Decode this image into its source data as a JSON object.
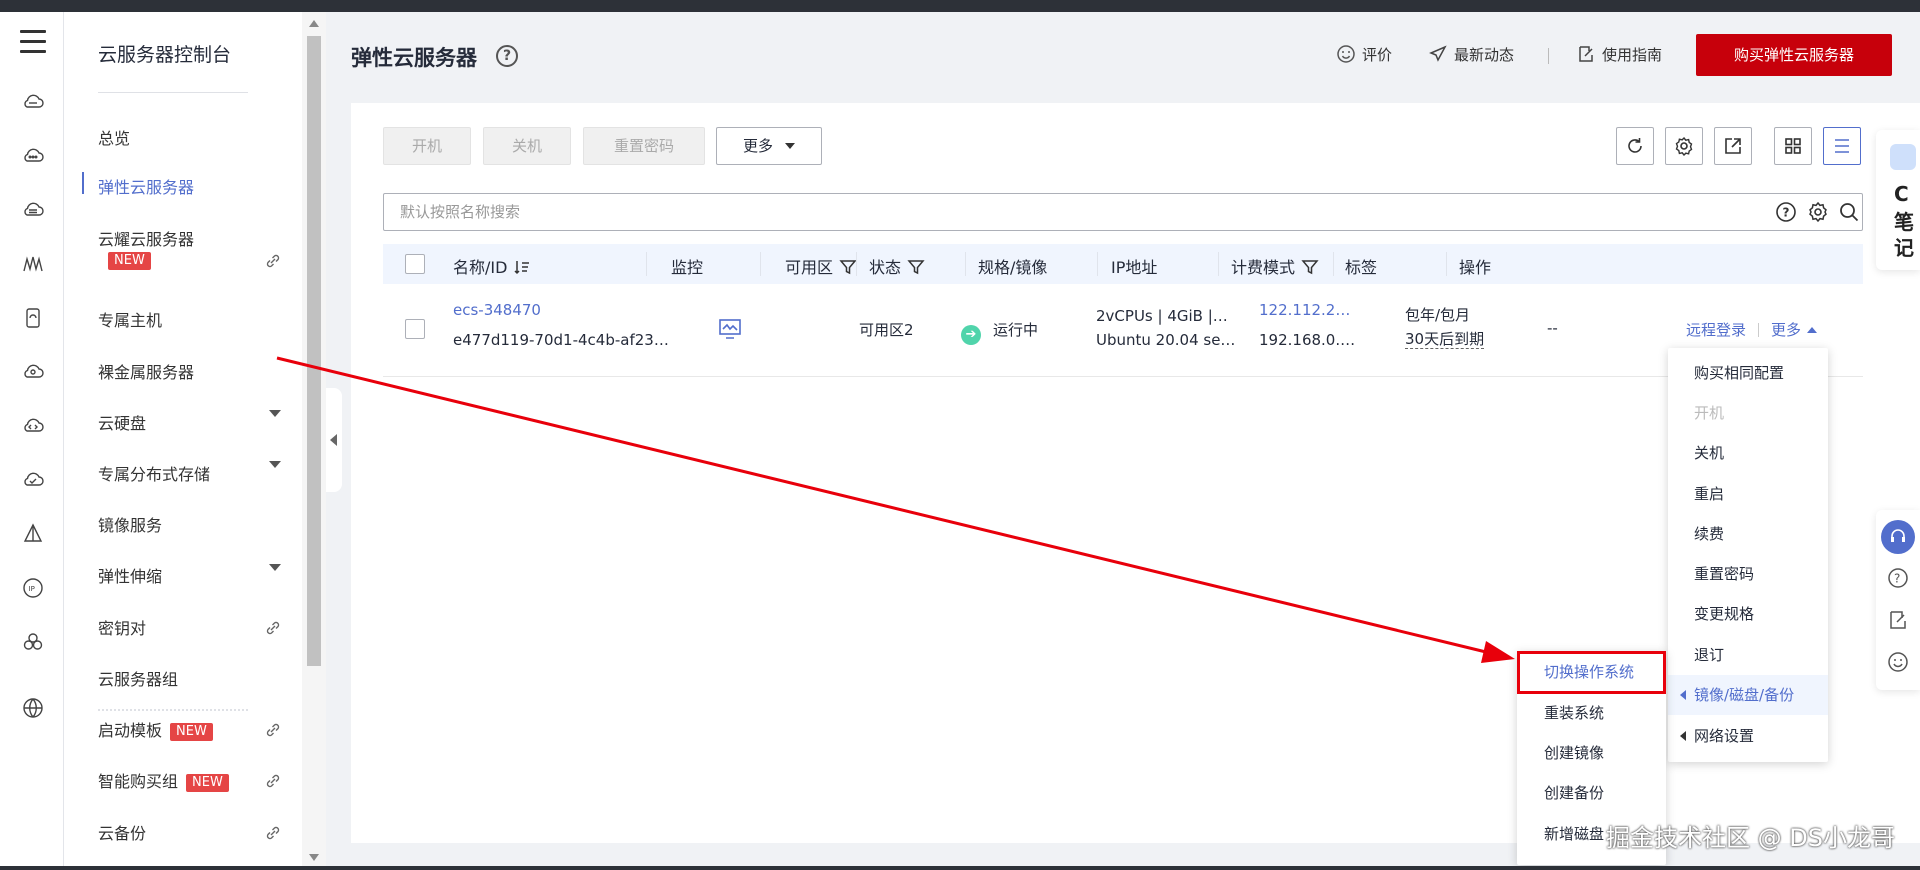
{
  "nav": {
    "title": "云服务器控制台",
    "items": [
      {
        "label": "总览"
      },
      {
        "label": "弹性云服务器"
      },
      {
        "label": "云耀云服务器",
        "badge": "NEW"
      },
      {
        "label": "专属主机"
      },
      {
        "label": "裸金属服务器"
      },
      {
        "label": "云硬盘"
      },
      {
        "label": "专属分布式存储"
      },
      {
        "label": "镜像服务"
      },
      {
        "label": "弹性伸缩"
      },
      {
        "label": "密钥对"
      },
      {
        "label": "云服务器组"
      },
      {
        "label": "启动模板",
        "badge": "NEW"
      },
      {
        "label": "智能购买组",
        "badge": "NEW"
      },
      {
        "label": "云备份"
      }
    ]
  },
  "header": {
    "title": "弹性云服务器",
    "help_icon": "?",
    "rate_label": "评价",
    "news_label": "最新动态",
    "guide_label": "使用指南",
    "buy_label": "购买弹性云服务器"
  },
  "toolbar": {
    "start_label": "开机",
    "stop_label": "关机",
    "reset_pwd_label": "重置密码",
    "more_label": "更多"
  },
  "search": {
    "placeholder": "默认按照名称搜索"
  },
  "table": {
    "columns": [
      "名称/ID",
      "监控",
      "可用区",
      "状态",
      "规格/镜像",
      "IP地址",
      "计费模式",
      "标签",
      "操作"
    ],
    "rows": [
      {
        "name": "ecs-348470",
        "id": "e477d119-70d1-4c4b-af23…",
        "zone": "可用区2",
        "status": "运行中",
        "spec": "2vCPUs | 4GiB |…",
        "image": "Ubuntu 20.04 se…",
        "ip_public": "122.112.2…",
        "ip_private": "192.168.0.…",
        "billing": "包年/包月",
        "expiry": "30天后到期",
        "tags": "--",
        "op_remote": "远程登录",
        "op_more": "更多"
      }
    ]
  },
  "more_menu": {
    "items": [
      {
        "label": "购买相同配置"
      },
      {
        "label": "开机"
      },
      {
        "label": "关机"
      },
      {
        "label": "重启"
      },
      {
        "label": "续费"
      },
      {
        "label": "重置密码"
      },
      {
        "label": "变更规格"
      },
      {
        "label": "退订"
      },
      {
        "label": "镜像/磁盘/备份"
      },
      {
        "label": "网络设置"
      }
    ]
  },
  "sub_menu": {
    "items": [
      {
        "label": "切换操作系统"
      },
      {
        "label": "重装系统"
      },
      {
        "label": "创建镜像"
      },
      {
        "label": "创建备份"
      },
      {
        "label": "新增磁盘"
      }
    ]
  },
  "right_float": {
    "c": "C",
    "t1": "笔",
    "t2": "记"
  },
  "watermark": "掘金技术社区 @ DS小龙哥",
  "colors": {
    "accent": "#526ecc",
    "brand_red": "#c7000b",
    "annotation_red": "#e8000b",
    "status_green": "#50d4ab"
  }
}
